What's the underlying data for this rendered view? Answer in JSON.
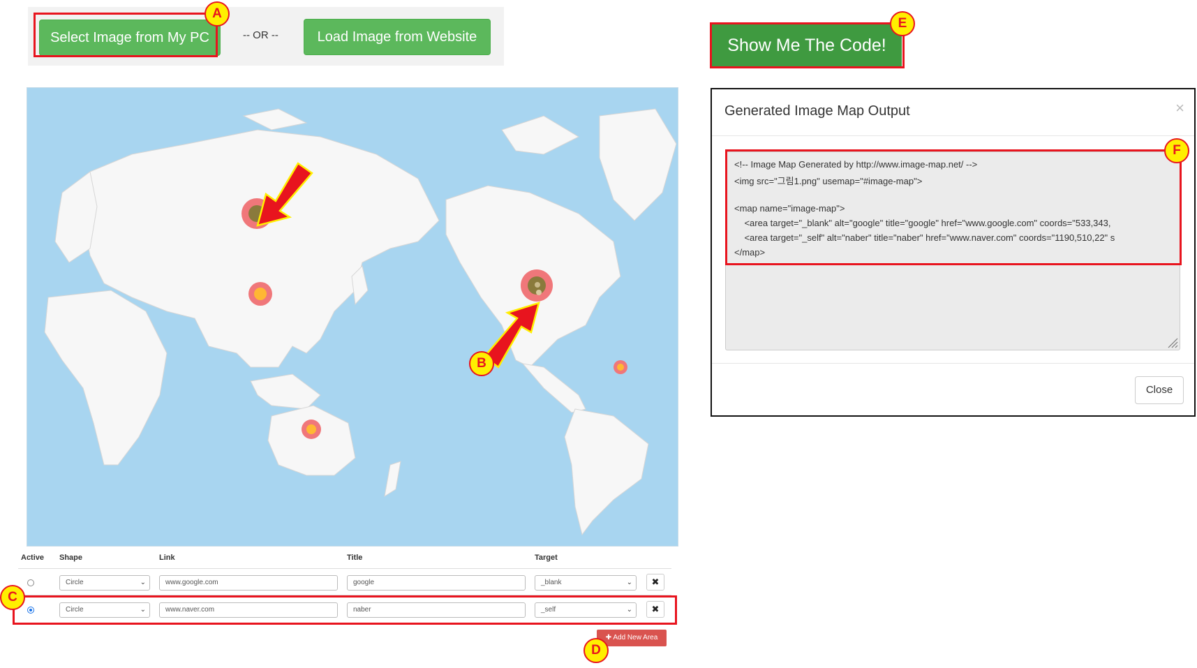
{
  "toolbar": {
    "select_pc_label": "Select Image from My PC",
    "or_label": "-- OR --",
    "load_web_label": "Load Image from Website"
  },
  "badges": {
    "a": "A",
    "b": "B",
    "c": "C",
    "d": "D",
    "e": "E",
    "f": "F"
  },
  "table": {
    "headers": {
      "active": "Active",
      "shape": "Shape",
      "link": "Link",
      "title": "Title",
      "target": "Target"
    },
    "rows": [
      {
        "active": false,
        "shape": "Circle",
        "link": "www.google.com",
        "title": "google",
        "target": "_blank"
      },
      {
        "active": true,
        "shape": "Circle",
        "link": "www.naver.com",
        "title": "naber",
        "target": "_self"
      }
    ],
    "delete_icon": "✖",
    "add_area_label": "✚ Add New Area"
  },
  "show_code_label": "Show Me The Code!",
  "modal": {
    "title": "Generated Image Map Output",
    "close_x": "×",
    "code_lines": [
      "<!-- Image Map Generated by http://www.image-map.net/ -->",
      "<img src=\"그림1.png\" usemap=\"#image-map\">",
      "",
      "<map name=\"image-map\">",
      "    <area target=\"_blank\" alt=\"google\" title=\"google\" href=\"www.google.com\" coords=\"533,343,",
      "    <area target=\"_self\" alt=\"naber\" title=\"naber\" href=\"www.naver.com\" coords=\"1190,510,22\" s",
      "</map>"
    ],
    "close_label": "Close"
  },
  "colors": {
    "accent_red": "#e8141e",
    "badge_yellow": "#ffef00",
    "green": "#5cb85c",
    "ocean": "#a8d5f0"
  },
  "icons": [
    "chevron-down-icon",
    "close-icon",
    "plus-icon",
    "resize-grip-icon"
  ]
}
